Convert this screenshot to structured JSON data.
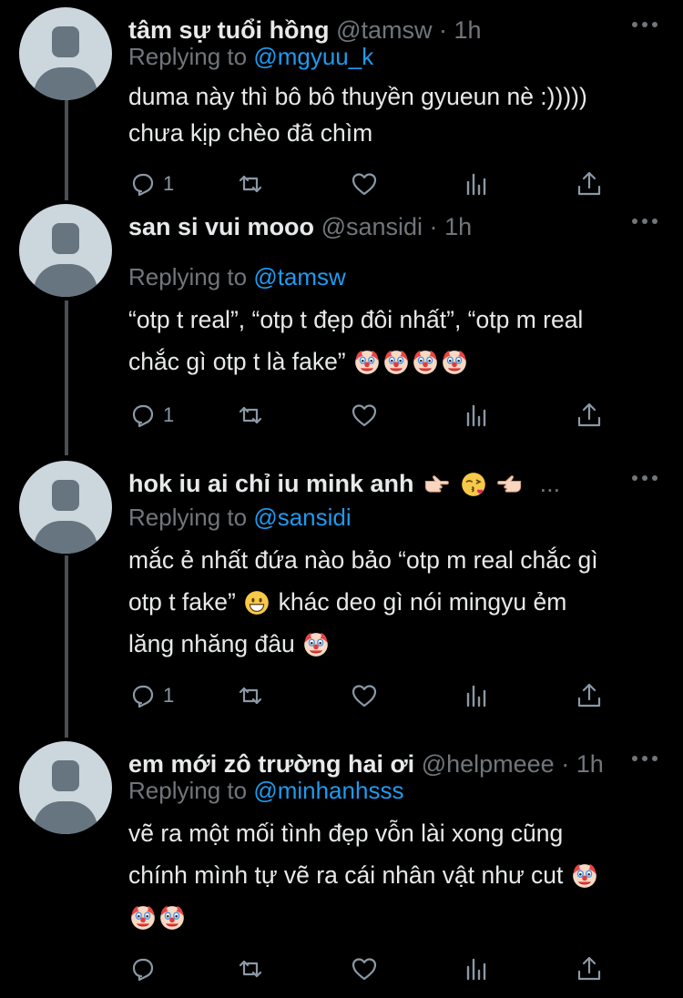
{
  "tweets": [
    {
      "name": "tâm sự tuổi hồng",
      "handle": "@tamsw",
      "dot": "·",
      "time": "1h",
      "replying_prefix": "Replying to",
      "replying_to": "@mgyuu_k",
      "lines": [
        "duma này thì bô bô thuyền gyueun nè :)))))",
        "chưa kịp chèo đã chìm"
      ],
      "reply_count": "1"
    },
    {
      "name": "san si vui mooo",
      "handle": "@sansidi",
      "dot": "·",
      "time": "1h",
      "replying_prefix": "Replying to",
      "replying_to": "@tamsw",
      "lines": [
        "“otp t real”, “otp t đẹp đôi nhất”, “otp m real",
        "chắc gì otp t là fake”"
      ],
      "reply_count": "1"
    },
    {
      "name": "hok iu ai chỉ iu mink anh",
      "handle": "",
      "dot": "...",
      "time": "",
      "replying_prefix": "Replying to",
      "replying_to": "@sansidi",
      "lines": [
        "mắc ẻ nhất đứa nào bảo “otp m real chắc gì",
        "otp t fake”",
        "lăng nhăng đâu"
      ],
      "line2_tail": "khác deo gì nói mingyu ẻm",
      "reply_count": "1"
    },
    {
      "name": "em mới zô trường hai ơi",
      "handle": "@helpmeee",
      "dot": "·",
      "time": "1h",
      "replying_prefix": "Replying to",
      "replying_to": "@minhanhsss",
      "lines": [
        "vẽ ra một mối tình đẹp vỗn lài xong cũng",
        "chính mình tự vẽ ra cái nhân vật như cut",
        ""
      ],
      "reply_count": ""
    }
  ],
  "icons": [
    "reply-icon",
    "retweet-icon",
    "like-icon",
    "views-icon",
    "share-icon",
    "clown-emoji",
    "grin-emoji",
    "kiss-emoji",
    "pointing-hand-emoji"
  ],
  "colors": {
    "background": "#000000",
    "link": "#1d9bf0",
    "muted": "#71767b",
    "text": "#e7e9ea",
    "avatar": "#ccd6dd"
  }
}
